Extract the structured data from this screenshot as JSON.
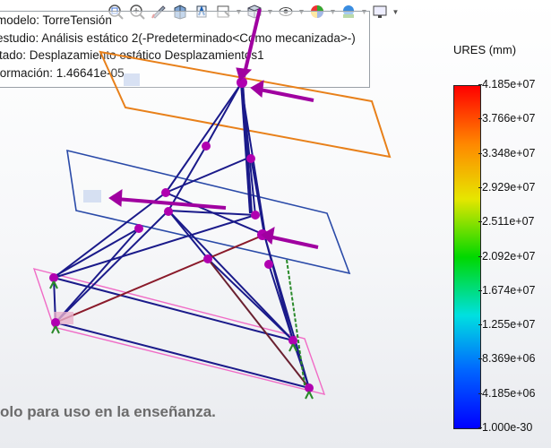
{
  "toolbar": {
    "icons": [
      "zoom-to-fit-icon",
      "zoom-area-icon",
      "previous-view-icon",
      "section-view-icon",
      "view-orientation-icon",
      "annotation-icon",
      "display-style-icon",
      "view-cube-icon",
      "hide-show-icon",
      "appearance-icon",
      "scene-icon",
      "monitor-icon"
    ]
  },
  "info": {
    "line1": "modelo: TorreTensión",
    "line2": "estudio: Análisis estático 2(-Predeterminado<Como mecanizada>-)",
    "line3": "ltado: Desplazamiento estático Desplazamientos1",
    "line4": "formación: 1.46641e-05"
  },
  "legend": {
    "title": "URES (mm)",
    "ticks": [
      "4.185e+07",
      "3.766e+07",
      "3.348e+07",
      "2.929e+07",
      "2.511e+07",
      "2.092e+07",
      "1.674e+07",
      "1.255e+07",
      "8.369e+06",
      "4.185e+06",
      "1.000e-30"
    ]
  },
  "footer": "olo para uso en la enseñanza.",
  "colors": {
    "beam": "#1a1a8a",
    "node": "#b000b0",
    "plane_top": "#e8801a",
    "plane_mid": "#2a4aa8",
    "plane_bottom": "#f06bc6",
    "fixture": "#2a8a2a"
  }
}
